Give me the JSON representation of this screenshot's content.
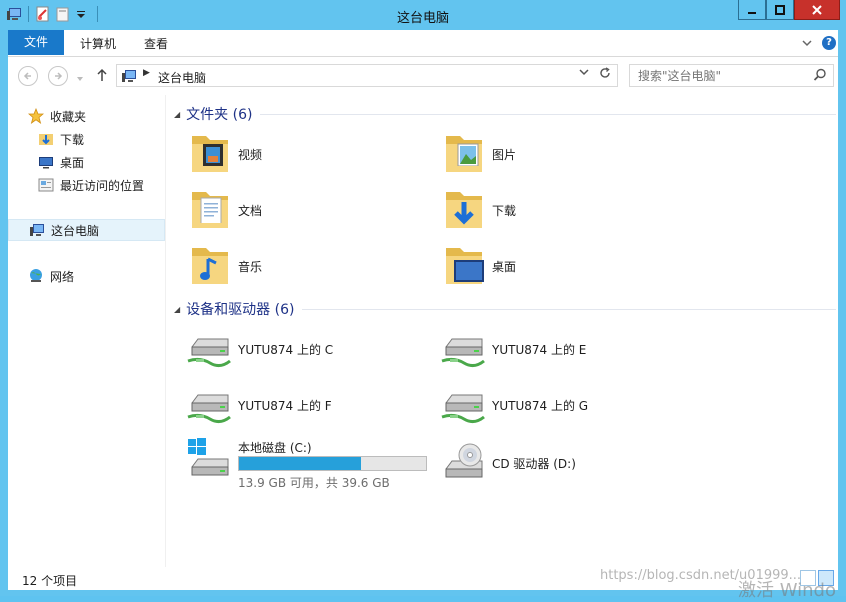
{
  "window": {
    "title": "这台电脑",
    "qat_icons": [
      "computer-icon",
      "properties-icon",
      "new-folder-icon",
      "customize-qat-chevron"
    ]
  },
  "ribbon": {
    "tabs": [
      "文件",
      "计算机",
      "查看"
    ]
  },
  "address": {
    "crumb": "这台电脑"
  },
  "search": {
    "placeholder": "搜索\"这台电脑\""
  },
  "sidebar": {
    "favorites_label": "收藏夹",
    "favorites": [
      "下载",
      "桌面",
      "最近访问的位置"
    ],
    "this_pc_label": "这台电脑",
    "network_label": "网络"
  },
  "groups": {
    "folders_title": "文件夹 (6)",
    "devices_title": "设备和驱动器 (6)"
  },
  "folders": [
    {
      "label": "视频",
      "icon": "videos-folder-icon"
    },
    {
      "label": "图片",
      "icon": "pictures-folder-icon"
    },
    {
      "label": "文档",
      "icon": "documents-folder-icon"
    },
    {
      "label": "下载",
      "icon": "downloads-folder-icon"
    },
    {
      "label": "音乐",
      "icon": "music-folder-icon"
    },
    {
      "label": "桌面",
      "icon": "desktop-folder-icon"
    }
  ],
  "network_drives": [
    {
      "label": "YUTU874 上的 C"
    },
    {
      "label": "YUTU874 上的 E"
    },
    {
      "label": "YUTU874 上的 F"
    },
    {
      "label": "YUTU874 上的 G"
    }
  ],
  "local_disk": {
    "label": "本地磁盘 (C:)",
    "info": "13.9 GB 可用，共 39.6 GB",
    "used_fraction": 0.65
  },
  "cd_drive": {
    "label": "CD 驱动器 (D:)"
  },
  "status": {
    "item_count": "12 个项目"
  },
  "watermark": {
    "url": "https://blog.csdn.net/u01999...",
    "activate": "激活 Windo"
  },
  "colors": {
    "frame": "#62c4ef",
    "file_tab": "#1979ca",
    "disk_bar": "#26a0da",
    "group_title": "#1e3287"
  }
}
